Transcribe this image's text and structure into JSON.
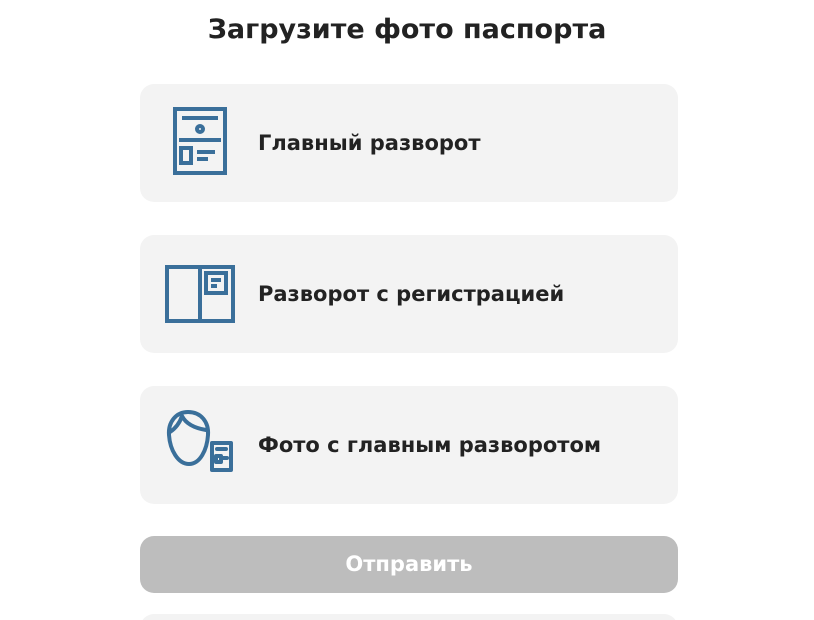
{
  "title": "Загрузите фото паспорта",
  "options": [
    {
      "label": "Главный разворот",
      "icon": "passport-main-page-icon"
    },
    {
      "label": "Разворот с регистрацией",
      "icon": "passport-registration-spread-icon"
    },
    {
      "label": "Фото с главным разворотом",
      "icon": "selfie-with-passport-icon"
    }
  ],
  "submit": {
    "label": "Отправить"
  },
  "colors": {
    "icon": "#3a6f9a",
    "card_background": "#f3f3f3",
    "submit_disabled": "#bdbdbd",
    "text": "#222222"
  }
}
